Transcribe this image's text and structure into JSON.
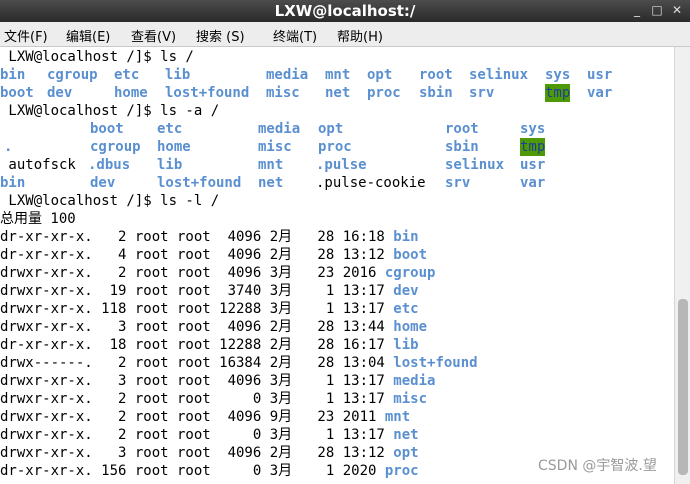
{
  "window": {
    "title": "LXW@localhost:/",
    "minimize": "_",
    "maximize": "□",
    "close": "✕"
  },
  "menu": [
    "文件(F)",
    "编辑(E)",
    "查看(V)",
    "搜索 (S)",
    "终端(T)",
    "帮助(H)"
  ],
  "colors": {
    "directory": "#5a8fd0",
    "highlight_bg": "#4e9a06"
  },
  "lines": [
    {
      "segs": [
        {
          "t": " LXW@localhost /]$ ls /",
          "s": "n"
        }
      ]
    },
    {
      "segs": [
        {
          "t": "bin",
          "s": "d"
        },
        {
          "t": "cgroup",
          "s": "d"
        },
        {
          "t": "etc",
          "s": "d"
        },
        {
          "t": "lib",
          "s": "d"
        },
        {
          "t": "media",
          "s": "d"
        },
        {
          "t": "mnt",
          "s": "d"
        },
        {
          "t": "opt",
          "s": "d"
        },
        {
          "t": "root",
          "s": "d"
        },
        {
          "t": "selinux",
          "s": "d"
        },
        {
          "t": "sys",
          "s": "d"
        },
        {
          "t": "usr",
          "s": "d"
        }
      ]
    },
    {
      "segs": [
        {
          "t": "boot",
          "s": "d"
        },
        {
          "t": "dev",
          "s": "d"
        },
        {
          "t": "home",
          "s": "d"
        },
        {
          "t": "lost+found",
          "s": "d"
        },
        {
          "t": "misc",
          "s": "d"
        },
        {
          "t": "net",
          "s": "d"
        },
        {
          "t": "proc",
          "s": "d"
        },
        {
          "t": "sbin",
          "s": "d"
        },
        {
          "t": "srv",
          "s": "d"
        },
        {
          "t": "tmp",
          "s": "h"
        },
        {
          "t": "var",
          "s": "d"
        }
      ]
    },
    {
      "segs": [
        {
          "t": " LXW@localhost /]$ ls -a /",
          "s": "n"
        }
      ]
    },
    {
      "segs": [
        {
          "t": "boot",
          "s": "d"
        },
        {
          "t": "etc",
          "s": "d"
        },
        {
          "t": "media",
          "s": "d"
        },
        {
          "t": "opt",
          "s": "d"
        },
        {
          "t": "root",
          "s": "d"
        },
        {
          "t": "sys",
          "s": "d"
        }
      ]
    },
    {
      "segs": [
        {
          "t": ".",
          "s": "d"
        },
        {
          "t": "cgroup",
          "s": "d"
        },
        {
          "t": "home",
          "s": "d"
        },
        {
          "t": "misc",
          "s": "d"
        },
        {
          "t": "proc",
          "s": "d"
        },
        {
          "t": "sbin",
          "s": "d"
        },
        {
          "t": "tmp",
          "s": "h"
        }
      ]
    },
    {
      "segs": [
        {
          "t": " autofsck",
          "s": "n"
        },
        {
          "t": ".dbus",
          "s": "d"
        },
        {
          "t": "lib",
          "s": "d"
        },
        {
          "t": "mnt",
          "s": "d"
        },
        {
          "t": ".pulse",
          "s": "d"
        },
        {
          "t": "selinux",
          "s": "d"
        },
        {
          "t": "usr",
          "s": "d"
        }
      ]
    },
    {
      "segs": [
        {
          "t": "bin",
          "s": "d"
        },
        {
          "t": "dev",
          "s": "d"
        },
        {
          "t": "lost+found",
          "s": "d"
        },
        {
          "t": "net",
          "s": "d"
        },
        {
          "t": ".pulse-cookie",
          "s": "n"
        },
        {
          "t": "srv",
          "s": "d"
        },
        {
          "t": "var",
          "s": "d"
        }
      ]
    },
    {
      "segs": [
        {
          "t": " LXW@localhost /]$ ls -l /",
          "s": "n"
        }
      ]
    },
    {
      "segs": [
        {
          "t": "总用量 100",
          "s": "n"
        }
      ]
    },
    {
      "segs": [
        {
          "t": "dr-xr-xr-x.   2 root root  4096 2月   28 16:18 ",
          "s": "n"
        },
        {
          "t": "bin",
          "s": "d"
        }
      ]
    },
    {
      "segs": [
        {
          "t": "dr-xr-xr-x.   4 root root  4096 2月   28 13:12 ",
          "s": "n"
        },
        {
          "t": "boot",
          "s": "d"
        }
      ]
    },
    {
      "segs": [
        {
          "t": "drwxr-xr-x.   2 root root  4096 3月   23 2016 ",
          "s": "n"
        },
        {
          "t": "cgroup",
          "s": "d"
        }
      ]
    },
    {
      "segs": [
        {
          "t": "drwxr-xr-x.  19 root root  3740 3月    1 13:17 ",
          "s": "n"
        },
        {
          "t": "dev",
          "s": "d"
        }
      ]
    },
    {
      "segs": [
        {
          "t": "drwxr-xr-x. 118 root root 12288 3月    1 13:17 ",
          "s": "n"
        },
        {
          "t": "etc",
          "s": "d"
        }
      ]
    },
    {
      "segs": [
        {
          "t": "drwxr-xr-x.   3 root root  4096 2月   28 13:44 ",
          "s": "n"
        },
        {
          "t": "home",
          "s": "d"
        }
      ]
    },
    {
      "segs": [
        {
          "t": "dr-xr-xr-x.  18 root root 12288 2月   28 16:17 ",
          "s": "n"
        },
        {
          "t": "lib",
          "s": "d"
        }
      ]
    },
    {
      "segs": [
        {
          "t": "drwx------.   2 root root 16384 2月   28 13:04 ",
          "s": "n"
        },
        {
          "t": "lost+found",
          "s": "d"
        }
      ]
    },
    {
      "segs": [
        {
          "t": "drwxr-xr-x.   3 root root  4096 3月    1 13:17 ",
          "s": "n"
        },
        {
          "t": "media",
          "s": "d"
        }
      ]
    },
    {
      "segs": [
        {
          "t": "drwxr-xr-x.   2 root root     0 3月    1 13:17 ",
          "s": "n"
        },
        {
          "t": "misc",
          "s": "d"
        }
      ]
    },
    {
      "segs": [
        {
          "t": "drwxr-xr-x.   2 root root  4096 9月   23 2011 ",
          "s": "n"
        },
        {
          "t": "mnt",
          "s": "d"
        }
      ]
    },
    {
      "segs": [
        {
          "t": "drwxr-xr-x.   2 root root     0 3月    1 13:17 ",
          "s": "n"
        },
        {
          "t": "net",
          "s": "d"
        }
      ]
    },
    {
      "segs": [
        {
          "t": "drwxr-xr-x.   3 root root  4096 2月   28 13:12 ",
          "s": "n"
        },
        {
          "t": "opt",
          "s": "d"
        }
      ]
    },
    {
      "segs": [
        {
          "t": "dr-xr-xr-x. 156 root root     0 3月    1 2020 ",
          "s": "n"
        },
        {
          "t": "proc",
          "s": "d"
        }
      ]
    }
  ],
  "watermark": "CSDN @宇智波.望"
}
